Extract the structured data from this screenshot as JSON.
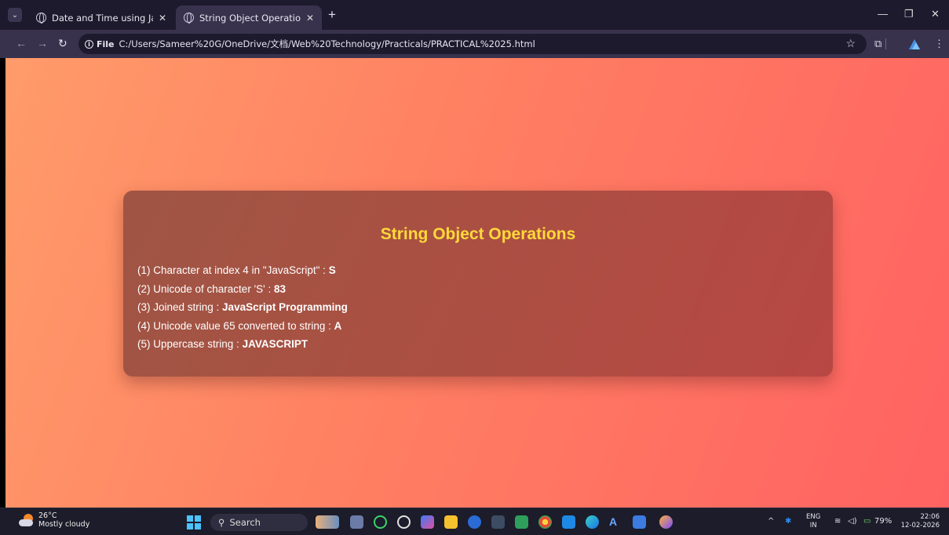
{
  "browser": {
    "tabs": [
      {
        "label": "Date and Time using JavaScript",
        "active": false
      },
      {
        "label": "String Object Operations",
        "active": true
      }
    ],
    "omnibox": {
      "chip_label": "File",
      "url": "C:/Users/Sameer%20G/OneDrive/文档/Web%20Technology/Practicals/PRACTICAL%2025.html"
    }
  },
  "page": {
    "title": "String Object Operations",
    "results": [
      {
        "label": "(1) Character at index 4 in \"JavaScript\" : ",
        "value": "S"
      },
      {
        "label": "(2) Unicode of character 'S' : ",
        "value": "83"
      },
      {
        "label": "(3) Joined string : ",
        "value": "JavaScript Programming"
      },
      {
        "label": "(4) Unicode value 65 converted to string : ",
        "value": "A"
      },
      {
        "label": "(5) Uppercase string : ",
        "value": "JAVASCRIPT"
      }
    ],
    "colors": {
      "title": "#ffd93a",
      "bg_start": "#ff9b6a",
      "bg_end": "#ff6262"
    }
  },
  "taskbar": {
    "weather_temp": "26°C",
    "weather_desc": "Mostly cloudy",
    "search_placeholder": "Search",
    "language_top": "ENG",
    "language_bottom": "IN",
    "battery": "79%",
    "time": "22:06",
    "date": "12-02-2026"
  }
}
